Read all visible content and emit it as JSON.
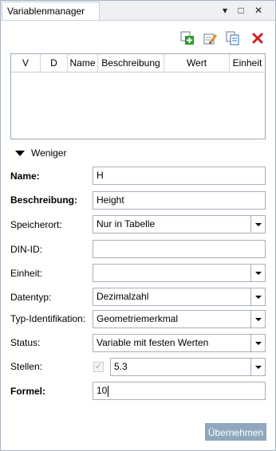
{
  "window": {
    "tab_title": "Variablenmanager",
    "controls": {
      "dropdown": "▾",
      "maximize": "□",
      "close": "✕"
    }
  },
  "toolbar": {
    "buttons": [
      {
        "name": "add-variable-icon",
        "color": "#2e9a2e"
      },
      {
        "name": "edit-variable-icon",
        "color": "#e08a1e"
      },
      {
        "name": "copy-variable-icon",
        "color": "#2f6db5"
      },
      {
        "name": "delete-variable-icon",
        "color": "#d31f1f"
      }
    ]
  },
  "table": {
    "columns": [
      "V",
      "D",
      "Name",
      "Beschreibung",
      "Wert",
      "Einheit"
    ],
    "rows": []
  },
  "toggle": {
    "label": "Weniger"
  },
  "form": {
    "name": {
      "label": "Name:",
      "value": "H"
    },
    "beschreibung": {
      "label": "Beschreibung:",
      "value": "Height"
    },
    "speicherort": {
      "label": "Speicherort:",
      "value": "Nur in Tabelle"
    },
    "din_id": {
      "label": "DIN-ID:",
      "value": ""
    },
    "einheit": {
      "label": "Einheit:",
      "value": ""
    },
    "datentyp": {
      "label": "Datentyp:",
      "value": "Dezimalzahl"
    },
    "typ_identifikation": {
      "label": "Typ-Identifikation:",
      "value": "Geometriemerkmal"
    },
    "status": {
      "label": "Status:",
      "value": "Variable mit festen Werten"
    },
    "stellen": {
      "label": "Stellen:",
      "checked": true,
      "value": "5.3"
    },
    "formel": {
      "label": "Formel:",
      "value": "10"
    }
  },
  "actions": {
    "apply_label": "Übernehmen"
  }
}
